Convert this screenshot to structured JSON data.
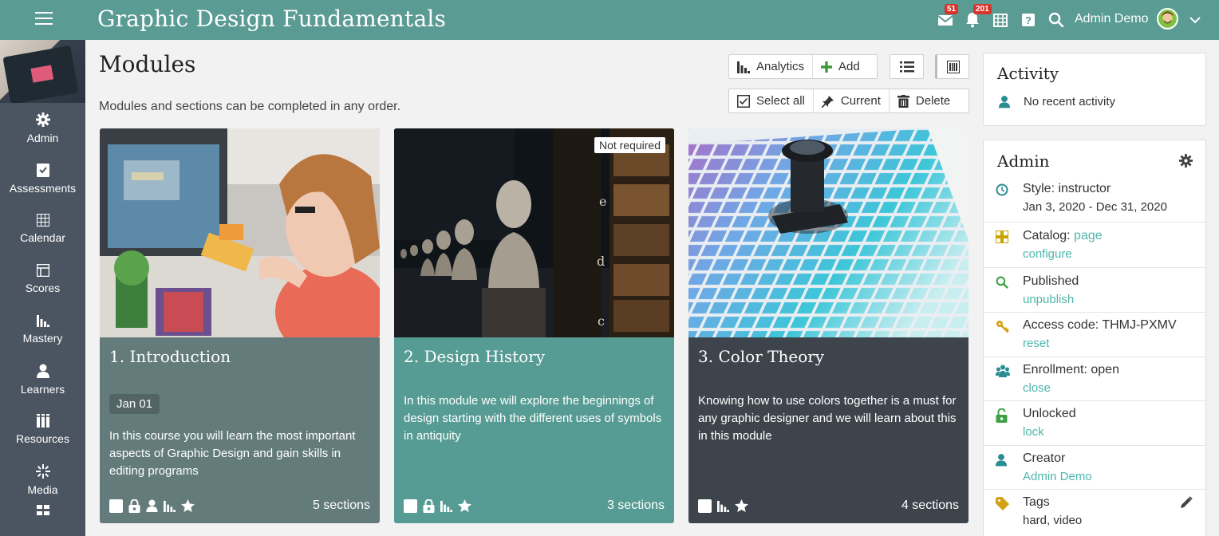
{
  "topbar": {
    "title": "Graphic Design Fundamentals",
    "mail_badge": "51",
    "notif_badge": "201",
    "user_name": "Admin Demo",
    "bg_color": "#5a9b93"
  },
  "sidebar": {
    "items": [
      {
        "label": "Admin",
        "icon": "gear-icon"
      },
      {
        "label": "Assessments",
        "icon": "checklist-icon"
      },
      {
        "label": "Calendar",
        "icon": "calendar-icon"
      },
      {
        "label": "Scores",
        "icon": "scores-icon"
      },
      {
        "label": "Mastery",
        "icon": "bar-chart-icon"
      },
      {
        "label": "Learners",
        "icon": "person-icon"
      },
      {
        "label": "Resources",
        "icon": "books-icon"
      },
      {
        "label": "Media",
        "icon": "sparkle-icon"
      }
    ]
  },
  "main": {
    "title": "Modules",
    "subtitle": "Modules and sections can be completed in any order.",
    "toolbar": {
      "analytics": "Analytics",
      "add": "Add",
      "select_all": "Select all",
      "current": "Current",
      "delete": "Delete"
    }
  },
  "modules": [
    {
      "title": "1. Introduction",
      "date": "Jan 01",
      "description": "In this course you will learn the most important aspects of Graphic Design and gain skills in editing programs",
      "sections": "5 sections",
      "color": "#647b7c"
    },
    {
      "title": "2. Design History",
      "badge": "Not required",
      "description": "In this module we will explore the beginnings of design starting with the different uses of symbols in antiquity",
      "sections": "3 sections",
      "color": "#579c94"
    },
    {
      "title": "3. Color Theory",
      "description": "Knowing how to use colors together is a must for any graphic designer and we will learn about this in this module",
      "sections": "4 sections",
      "color": "#3e444c"
    }
  ],
  "activity": {
    "title": "Activity",
    "empty": "No recent activity"
  },
  "admin": {
    "title": "Admin",
    "style_label": "Style: instructor",
    "style_dates": "Jan 3, 2020 - Dec 31, 2020",
    "catalog_label": "Catalog:",
    "catalog_value": "page",
    "catalog_link": "configure",
    "published": "Published",
    "unpublish": "unpublish",
    "access_code": "Access code: THMJ-PXMV",
    "reset": "reset",
    "enrollment": "Enrollment: open",
    "close": "close",
    "unlocked": "Unlocked",
    "lock": "lock",
    "creator": "Creator",
    "creator_name": "Admin Demo",
    "tags": "Tags",
    "tags_value": "hard, video",
    "link_color": "#4db6ac"
  }
}
